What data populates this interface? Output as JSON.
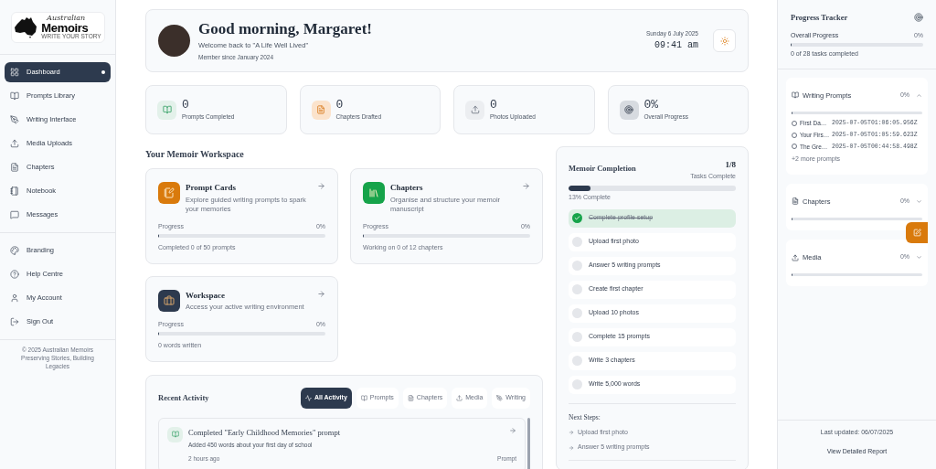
{
  "sidebar": {
    "logo": {
      "small": "Australian",
      "big": "Memoirs",
      "tagline": "WRITE YOUR STORY"
    },
    "nav": [
      {
        "label": "Dashboard",
        "selected": true
      },
      {
        "label": "Prompts Library",
        "selected": false
      },
      {
        "label": "Writing Interface",
        "selected": false
      },
      {
        "label": "Media Uploads",
        "selected": false
      },
      {
        "label": "Chapters",
        "selected": false
      },
      {
        "label": "Notebook",
        "selected": false
      },
      {
        "label": "Messages",
        "selected": false
      }
    ],
    "account": [
      {
        "label": "Branding"
      },
      {
        "label": "Help Centre"
      },
      {
        "label": "My Account"
      },
      {
        "label": "Sign Out"
      }
    ],
    "footer": [
      "© 2025 Australian Memoirs",
      "Preserving Stories, Building Legacies"
    ]
  },
  "header": {
    "greeting": "Good morning, Margaret!",
    "welcome": "Welcome back to \"A Life Well Lived\"",
    "member_since": "Member since January 2024",
    "date": "Sunday 6 July 2025",
    "time": "09:41 am"
  },
  "stats": [
    {
      "value": "0",
      "label": "Prompts Completed"
    },
    {
      "value": "0",
      "label": "Chapters Drafted"
    },
    {
      "value": "0",
      "label": "Photos Uploaded"
    },
    {
      "value": "0%",
      "label": "Overall Progress"
    }
  ],
  "workspace": {
    "title": "Your Memoir Workspace",
    "cards": [
      {
        "title": "Prompt Cards",
        "description": "Explore guided writing prompts to spark your memories",
        "progress_label": "Progress",
        "percent": "0%",
        "level": 0,
        "note": "Completed 0 of 50 prompts"
      },
      {
        "title": "Chapters",
        "description": "Organise and structure your memoir manuscript",
        "progress_label": "Progress",
        "percent": "0%",
        "level": 0,
        "note": "Working on 0 of 12 chapters"
      },
      {
        "title": "Workspace",
        "description": "Access your active writing environment",
        "progress_label": "Progress",
        "percent": "0%",
        "level": 0,
        "note": "0 words written"
      }
    ]
  },
  "activity": {
    "title": "Recent Activity",
    "filters": [
      {
        "label": "All Activity",
        "selected": true
      },
      {
        "label": "Prompts",
        "selected": false
      },
      {
        "label": "Chapters",
        "selected": false
      },
      {
        "label": "Media",
        "selected": false
      },
      {
        "label": "Writing",
        "selected": false
      }
    ],
    "items": [
      {
        "title": "Completed \"Early Childhood Memories\" prompt",
        "description": "Added 450 words about your first day of school",
        "time": "2 hours ago",
        "type": "Prompt"
      }
    ]
  },
  "completion": {
    "title": "Memoir Completion",
    "count": "1/8",
    "count_label": "Tasks Complete",
    "level": 0.13,
    "percent_label": "13% Complete",
    "tasks": [
      {
        "label": "Complete profile setup",
        "checked": true
      },
      {
        "label": "Upload first photo",
        "checked": false
      },
      {
        "label": "Answer 5 writing prompts",
        "checked": false
      },
      {
        "label": "Create first chapter",
        "checked": false
      },
      {
        "label": "Upload 10 photos",
        "checked": false
      },
      {
        "label": "Complete 15 prompts",
        "checked": false
      },
      {
        "label": "Write 3 chapters",
        "checked": false
      },
      {
        "label": "Write 5,000 words",
        "checked": false
      }
    ],
    "next_title": "Next Steps:",
    "next_steps": [
      "Upload first photo",
      "Answer 5 writing prompts"
    ]
  },
  "tracker": {
    "title": "Progress Tracker",
    "overall_label": "Overall Progress",
    "overall_percent": "0%",
    "level": 0,
    "note": "0 of 28 tasks completed",
    "sections": [
      {
        "title": "Writing Prompts",
        "percent": "0%",
        "level": 0,
        "expanded": true,
        "items": [
          {
            "name": "First Da…",
            "timestamp": "2025-07-05T01:06:05.956Z",
            "checked": false
          },
          {
            "name": "Your Firs…",
            "timestamp": "2025-07-05T01:05:59.623Z",
            "checked": false
          },
          {
            "name": "The Gre…",
            "timestamp": "2025-07-05T00:44:58.498Z",
            "checked": false
          }
        ],
        "more": "+2 more prompts"
      },
      {
        "title": "Chapters",
        "percent": "0%",
        "level": 0,
        "expanded": false
      },
      {
        "title": "Media",
        "percent": "0%",
        "level": 0,
        "expanded": false
      }
    ],
    "last_updated": "Last updated: 06/07/2025",
    "report_link": "View Detailed Report"
  }
}
